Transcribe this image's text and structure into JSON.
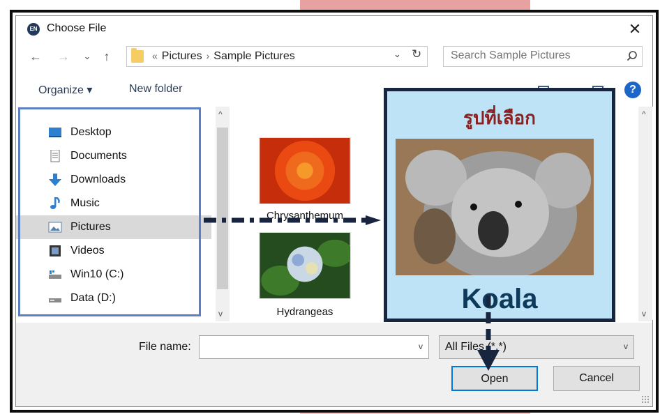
{
  "window": {
    "title": "Choose File",
    "app_icon_text": "EN"
  },
  "nav": {
    "back": "←",
    "forward": "→",
    "recent": "⌄",
    "up": "↑",
    "breadcrumb_prefix": "«",
    "breadcrumbs": [
      "Pictures",
      "Sample Pictures"
    ],
    "refresh": "↻"
  },
  "search": {
    "placeholder": "Search Sample Pictures"
  },
  "toolbar": {
    "organize_label": "Organize ▾",
    "new_folder_label": "New folder",
    "help_label": "?"
  },
  "sidebar": {
    "items": [
      {
        "label": "Desktop",
        "icon": "desktop-icon"
      },
      {
        "label": "Documents",
        "icon": "documents-icon"
      },
      {
        "label": "Downloads",
        "icon": "downloads-icon"
      },
      {
        "label": "Music",
        "icon": "music-icon"
      },
      {
        "label": "Pictures",
        "icon": "pictures-icon",
        "selected": true
      },
      {
        "label": "Videos",
        "icon": "videos-icon"
      },
      {
        "label": "Win10 (C:)",
        "icon": "drive-c-icon"
      },
      {
        "label": "Data (D:)",
        "icon": "drive-d-icon"
      }
    ]
  },
  "files": [
    {
      "label": "Chrysanthemum"
    },
    {
      "label": "Hydrangeas"
    }
  ],
  "callout": {
    "title": "รูปที่เลือก",
    "caption": "Koala"
  },
  "footer": {
    "file_name_label": "File name:",
    "file_name_value": "",
    "filter_value": "All Files (*.*)",
    "open_label": "Open",
    "cancel_label": "Cancel"
  },
  "colors": {
    "accent": "#0078d7",
    "callout_bg": "#bfe3f6",
    "callout_border": "#17253f",
    "arrow": "#17253f",
    "highlight_box": "#5a7fc2",
    "title_red": "#8c1f1f"
  }
}
